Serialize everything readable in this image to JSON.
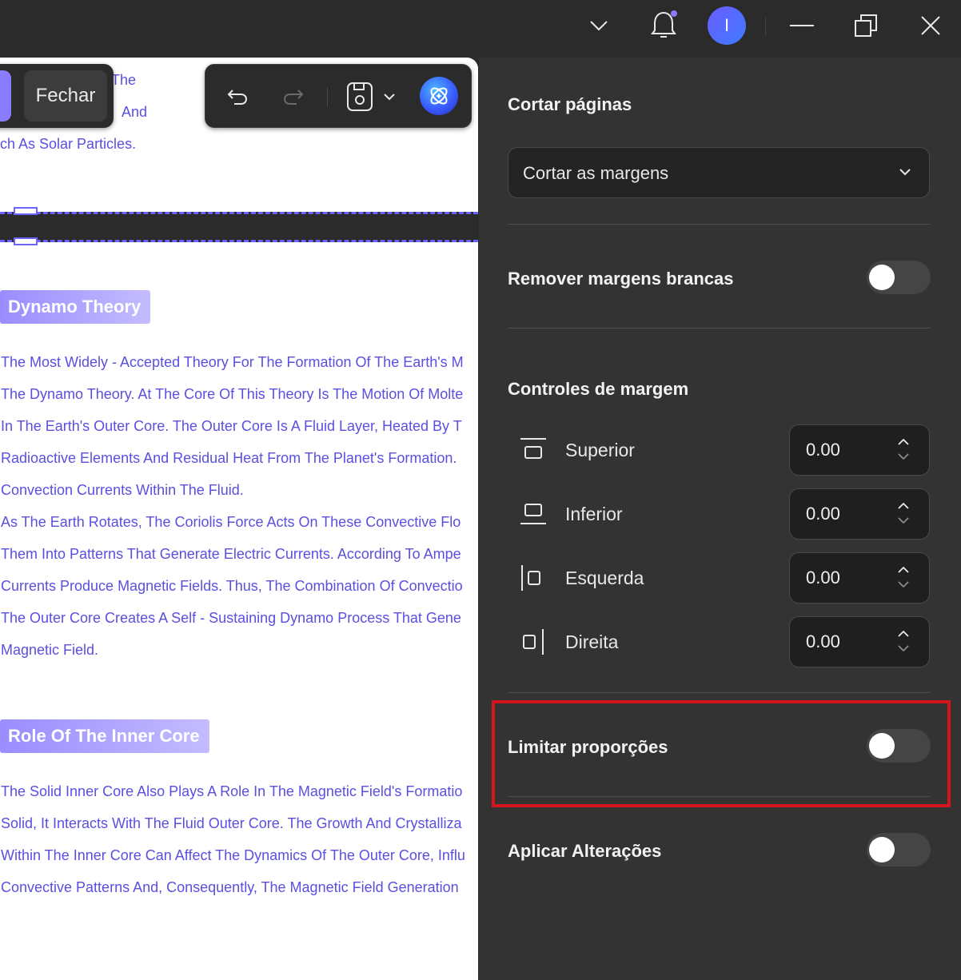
{
  "titlebar": {
    "avatar_initial": "I"
  },
  "doc": {
    "close_label": "Fechar",
    "top_fragments": [
      "The",
      "And",
      "ch As Solar Particles."
    ],
    "heading1": "Dynamo Theory",
    "para1": [
      "The Most Widely - Accepted Theory For The Formation Of The Earth's M",
      "The Dynamo Theory. At The Core Of This Theory Is The Motion Of Molte",
      "In The Earth's Outer Core. The Outer Core Is A Fluid Layer, Heated By T",
      "Radioactive Elements And Residual Heat From The Planet's Formation.",
      "Convection Currents Within The Fluid.",
      "As The Earth Rotates, The Coriolis Force Acts On These Convective Flo",
      "Them Into Patterns That Generate Electric Currents. According To Ampe",
      "Currents Produce Magnetic Fields. Thus, The Combination Of Convectio",
      "The Outer Core Creates A Self - Sustaining Dynamo Process That Gene",
      "Magnetic Field."
    ],
    "heading2": "Role Of The Inner Core",
    "para2": [
      "The Solid Inner Core Also Plays A Role In The Magnetic Field's Formatio",
      "Solid, It Interacts With The Fluid Outer Core. The Growth And Crystalliza",
      "Within The Inner Core Can Affect The Dynamics Of The Outer Core, Influ",
      "Convective Patterns And, Consequently, The Magnetic Field Generation"
    ]
  },
  "panel": {
    "crop_title": "Cortar páginas",
    "crop_mode": "Cortar as margens",
    "remove_white_label": "Remover margens brancas",
    "remove_white_on": false,
    "margin_controls_title": "Controles de margem",
    "margins": [
      {
        "label": "Superior",
        "value": "0.00",
        "icon": "margin-top-icon"
      },
      {
        "label": "Inferior",
        "value": "0.00",
        "icon": "margin-bottom-icon"
      },
      {
        "label": "Esquerda",
        "value": "0.00",
        "icon": "margin-left-icon"
      },
      {
        "label": "Direita",
        "value": "0.00",
        "icon": "margin-right-icon"
      }
    ],
    "limit_proportions_label": "Limitar proporções",
    "limit_proportions_on": false,
    "apply_changes_label": "Aplicar Alterações",
    "apply_changes_on": false
  },
  "colors": {
    "accent": "#6b62ff",
    "doc_text": "#5b4fe0",
    "highlight": "#d4161c"
  }
}
